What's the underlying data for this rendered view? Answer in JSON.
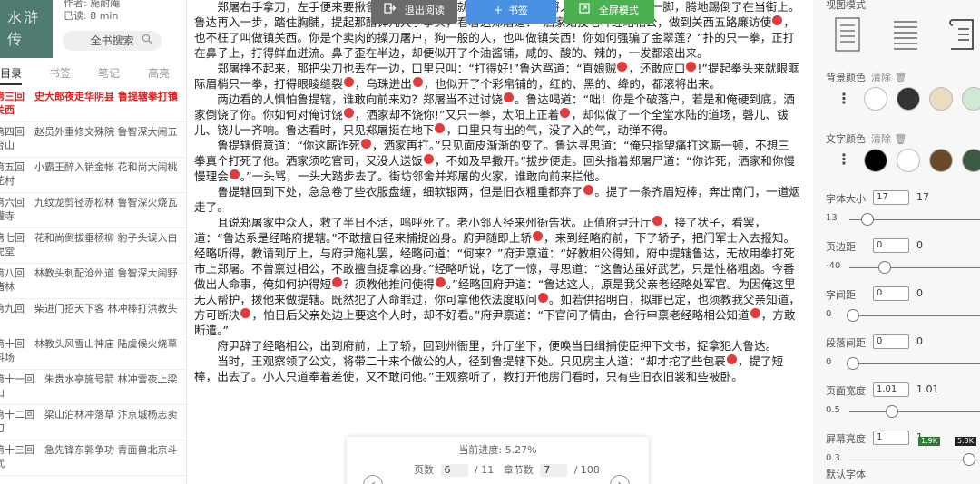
{
  "left": {
    "cover_text": "水浒传",
    "book_meta": [
      "作者: 施耐庵",
      "已读: 8 min"
    ],
    "search_label": "全书搜索",
    "search_icon": "search-icon",
    "tabs": [
      "目录",
      "书签",
      "笔记",
      "高亮"
    ],
    "toc": [
      {
        "title": "第三回　史大郎夜走华阴县 鲁提辖拳打镇关西",
        "current": true
      },
      {
        "title": "第四回　赵员外重修文殊院 鲁智深大闹五台山",
        "current": false
      },
      {
        "title": "第五回　小霸王醉入销金帐 花和尚大闹桃花村",
        "current": false
      },
      {
        "title": "第六回　九纹龙剪径赤松林 鲁智深火烧瓦罐寺",
        "current": false
      },
      {
        "title": "第七回　花和尚倒拔垂杨柳 豹子头误入白虎堂",
        "current": false
      },
      {
        "title": "第八回　林教头刺配沧州道 鲁智深大闹野猪林",
        "current": false
      },
      {
        "title": "第九回　柴进门招天下客 林冲棒打洪教头",
        "current": false
      },
      {
        "title": "第十回　林教头风雪山神庙 陆虞候火烧草料场",
        "current": false
      },
      {
        "title": "第十一回　朱贵水亭施号箭 林冲雪夜上梁山",
        "current": false
      },
      {
        "title": "第十二回　梁山泊林冲落草 汴京城杨志卖刀",
        "current": false
      },
      {
        "title": "第十三回　急先锋东郭争功 青面兽北京斗武",
        "current": false
      }
    ]
  },
  "toolbar": {
    "exit": "退出阅读",
    "bookmark": "书签",
    "fullscreen": "全屏模式"
  },
  "reader": {
    "paragraphs": [
      [
        {
          "t": "郑屠右手拿刀，左手便来要揪鲁达，被这鲁提辖就势按住左手，赶将入去，望小腹上只一脚，腾地踢倒了在当街上。鲁达再入一步，踏住胸脯，提起那醋钵儿大小拳头，看着这郑屠道："
        },
        {
          "t": "“洒家始投老种经略相公，做到关西五路廉访使"
        },
        {
          "n": true
        },
        {
          "t": "，也不枉了叫做镇关西。你是个卖肉的操刀屠户，狗一般的人，也叫做镇关西！你如何强骗了金翠莲？”扑的只一拳，正打在鼻子上，打得鲜血迸流。鼻子歪在半边，却便似开了个油酱铺，咸的、酸的、辣的，一发都滚出来。"
        }
      ],
      [
        {
          "t": "郑屠挣不起来，那把尖刀也丢在一边，口里只叫：“打得好!”鲁达骂道：“直娘贼"
        },
        {
          "n": true
        },
        {
          "t": "，还敢应口"
        },
        {
          "n": true
        },
        {
          "t": "!”提起拳头来就眼眶际眉梢只一拳，打得眼睖缝裂"
        },
        {
          "n": true
        },
        {
          "t": "，乌珠迸出"
        },
        {
          "n": true
        },
        {
          "t": "，也似开了个彩帛铺的，红的、黑的、绛的，都滚将出来。"
        }
      ],
      [
        {
          "t": "两边看的人惧怕鲁提辖，谁敢向前来劝？郑屠当不过讨饶"
        },
        {
          "n": true
        },
        {
          "t": "。鲁达喝道：“咄！你是个破落户，若是和俺硬到底，洒家倒饶了你。你如何对俺讨饶"
        },
        {
          "n": true
        },
        {
          "t": "，洒家却不饶你!”又只一拳，太阳上正着"
        },
        {
          "n": true
        },
        {
          "t": "，却似做了一个全堂水陆的道场，磬儿、钹儿、铙儿一齐响。鲁达看时，只见郑屠挺在地下"
        },
        {
          "n": true
        },
        {
          "t": "，口里只有出的气，没了入的气，动弹不得。"
        }
      ],
      [
        {
          "t": "鲁提辖假意道：“你这厮诈死"
        },
        {
          "n": true
        },
        {
          "t": "，洒家再打。”只见面皮渐渐的变了。鲁达寻思道：“俺只指望痛打这厮一顿，不想三拳真个打死了他。洒家须吃官司，又没人送饭"
        },
        {
          "n": true
        },
        {
          "t": "，不如及早撒开。”拔步便走。回头指着郑屠尸道：“你诈死，洒家和你慢慢理会"
        },
        {
          "n": true
        },
        {
          "t": "。”一头骂，一头大踏步去了。街坊邻舍并郑屠的火家，谁敢向前来拦他。"
        }
      ],
      [
        {
          "t": "鲁提辖回到下处，急急卷了些衣服盘缠，细软银两，但是旧衣粗重都弃了"
        },
        {
          "n": true
        },
        {
          "t": "。提了一条齐眉短棒，奔出南门，一道烟走了。"
        }
      ],
      [
        {
          "t": "且说郑屠家中众人，救了半日不活，呜呼死了。老小邻人径来州衙告状。正值府尹升厅"
        },
        {
          "n": true
        },
        {
          "t": "，接了状子，看罢，道：“鲁达系是经略府提辖。”不敢擅自径来捕捉凶身。府尹随即上轿"
        },
        {
          "n": true
        },
        {
          "t": "，来到经略府前，下了轿子，把门军士入去报知。经略听得，教请到厅上，与府尹施礼罢，经略问道：“何来？”府尹禀道：“好教相公得知，府中提辖鲁达，无故用拳打死市上郑屠。不曾禀过相公，不敢擅自捉拿凶身。”经略听说，吃了一惊，寻思道：“这鲁达虽好武艺，只是性格粗卤。今番做出人命事，俺如何护得短"
        },
        {
          "n": true
        },
        {
          "t": "？须教他推问使得"
        },
        {
          "n": true
        },
        {
          "t": "。”经略回府尹道：“鲁达这人，原是我父亲老经略处军官。为因俺这里无人帮护，拨他来做提辖。既然犯了人命罪过，你可拿他依法度取问"
        },
        {
          "n": true
        },
        {
          "t": "。如若供招明白，拟罪已定，也须教我父亲知道，方可断决"
        },
        {
          "n": true
        },
        {
          "t": "，怕日后父亲处边上要这个人时，却不好看。”府尹禀道：“下官问了情由，合行申禀老经略相公知道"
        },
        {
          "n": true
        },
        {
          "t": "，方敢断遣。”"
        }
      ],
      [
        {
          "t": "府尹辞了经略相公，出到府前，上了轿，回到州衙里，升厅坐下，便唤当日缉捕使臣押下文书，捉拿犯人鲁达。"
        }
      ],
      [
        {
          "t": "当时，王观察领了公文，将带二十来个做公的人，径到鲁提辖下处。只见房主人道：“却才拕了些包裹"
        },
        {
          "n": true
        },
        {
          "t": "，提了短棒，出去了。小人只道奉着差使，又不敢问他。”王观察听了，教打开他房门看时，只有些旧衣旧裳和些被卧。"
        }
      ]
    ]
  },
  "progress": {
    "label": "当前进度: 5.27%",
    "page_label": "页数",
    "page": "6",
    "page_total": "/ 11",
    "chapter_label": "章节数",
    "chapter": "7",
    "chapter_total": "/ 108",
    "prev_icon": "chevron-left-icon",
    "next_icon": "chevron-right-icon"
  },
  "settings": {
    "view_label": "视图模式",
    "bg_label": "背景颜色",
    "clear": "清除",
    "clear_icon": "trash-icon",
    "bg_colors": [
      "#ffffff",
      "#333333",
      "#e9dcc0",
      "#cfe9d4"
    ],
    "text_label": "文字颜色",
    "text_colors": [
      "#000000",
      "#ffffff",
      "#6b4a2b",
      "#3c5a45"
    ],
    "sliders": [
      {
        "name": "font-size",
        "label": "字体大小",
        "value": "17",
        "min": "13",
        "pos": 0.14
      },
      {
        "name": "padding",
        "label": "页边距",
        "value": "0",
        "min": "-40",
        "pos": 0.28
      },
      {
        "name": "letter-spacing",
        "label": "字间距",
        "value": "0",
        "min": "0",
        "pos": 0.02
      },
      {
        "name": "paragraph-spacing",
        "label": "段落间距",
        "value": "0",
        "min": "0",
        "pos": 0.02
      },
      {
        "name": "page-width",
        "label": "页面宽度",
        "value": "1.01",
        "min": "0.5",
        "pos": 0.34
      },
      {
        "name": "brightness",
        "label": "屏幕亮度",
        "value": "1",
        "min": "0.3",
        "pos": 0.98
      }
    ],
    "default_font": "默认字体",
    "perf_badges": [
      "1.9K",
      "5.3K"
    ]
  }
}
